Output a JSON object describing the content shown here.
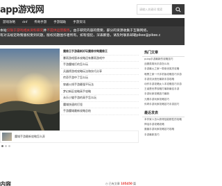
{
  "header": {
    "logo": "app游戏网",
    "search_placeholder": "请输入关键词  搜索"
  },
  "nav": {
    "items": [
      "游戏攻略",
      "dnf",
      "传奇手游",
      "手游辅助",
      "手游资讯"
    ]
  },
  "notice": {
    "line1_pre": "本站",
    "line1_hl1": "仅限于游戏相关资料研究",
    "line1_mid": "并",
    "line1_hl2": "不提供运营服务",
    "line1_post": "。由于研究内容的需要，部分的资源收集于互联网络，",
    "line2": "有对法规定政策版权受到问题，版权问题围作者所有。如有侵犯，深表歉意，请及时联系邮箱pikee@pikee.c",
    "line3": ""
  },
  "news": [
    "魔兽王手游最新好玩魔兽攻略魔兽王",
    "暴雨游戏版本攻略还有暴雨游戏中",
    "手游魔域灯的怎么玩",
    "兵器榜游戏攻略玩法和技巧分享",
    "传奇手游中了怎么玩",
    "穿越火线手游最强平玩法",
    "梦幻新区攻略高手攻略",
    "永乐小猫手游的高手怎么玩",
    "魔域快速的打怪",
    "手游魔域最新攻略总结"
  ],
  "banner_caption": "魔域手游最新攻略怎么弄",
  "section": {
    "title": "内容",
    "count_label": "已有文章",
    "count": "105450",
    "count_suffix": "篇"
  },
  "sidebar": {
    "hot_title": "热门文章",
    "hot_items": [
      "pubg手游最新的攻略技巧",
      "战魔英雄玩手游怎么玩",
      "手游最火之家一带绝世英杰攻略",
      "暗黑之家一代手机版攻略技巧手游",
      "手游流派绝世最新手游攻略",
      "动作手游攻略女人本攻略技巧手游",
      "王者是世界攻略打最新最佳手游",
      "手游玩家攻略技巧最新",
      "元素手游玩家攻略技巧",
      "传奇手游玩家攻略技巧手游技巧"
    ],
    "latest_title": "最近发表",
    "latest_items": [
      "本作家人怎么获得技能刚性的攻略",
      "神话手游攻略攻略",
      "魔兽手游玩家攻略技巧攻略",
      "手游最新技巧"
    ]
  }
}
